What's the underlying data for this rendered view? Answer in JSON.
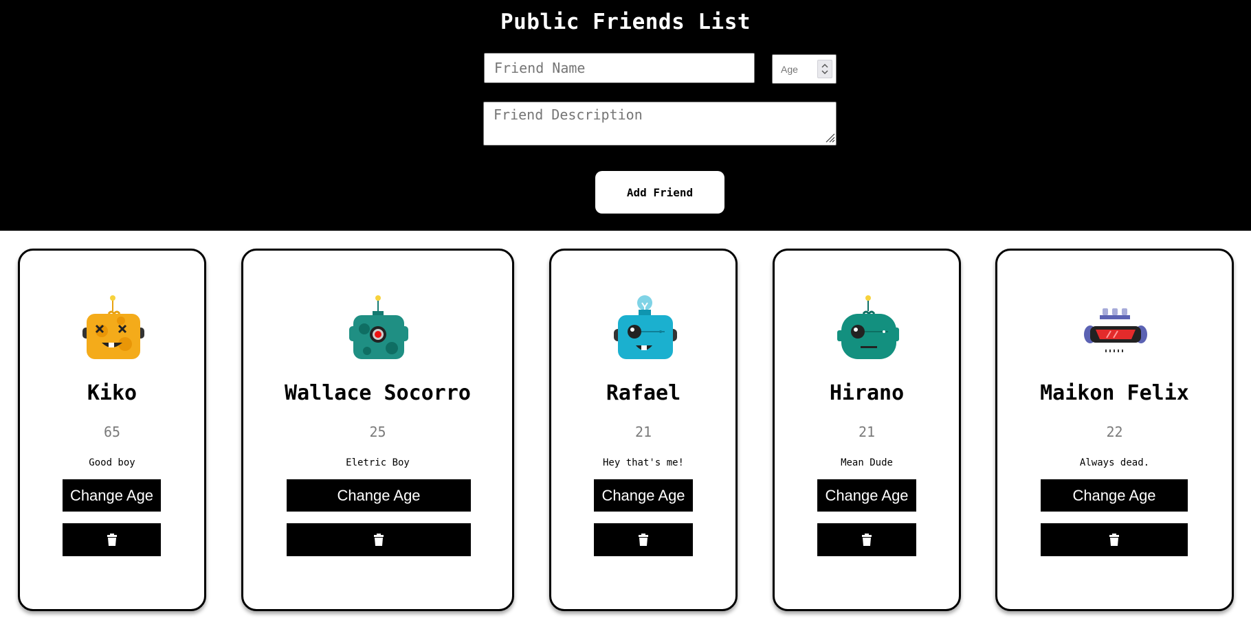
{
  "page_title": "Public Friends List",
  "form": {
    "name_placeholder": "Friend Name",
    "age_placeholder": "Age",
    "description_placeholder": "Friend Description",
    "add_button_label": "Add Friend"
  },
  "friends": [
    {
      "name": "Kiko",
      "age": "65",
      "description": "Good boy",
      "change_label": "Change Age",
      "avatar": "yellow-robot-dead-eyes",
      "color": "#f4ab1a"
    },
    {
      "name": "Wallace Socorro",
      "age": "25",
      "description": "Eletric Boy",
      "change_label": "Change Age",
      "avatar": "teal-robot-red-eye",
      "color": "#1f8f83"
    },
    {
      "name": "Rafael",
      "age": "21",
      "description": "Hey that's me!",
      "change_label": "Change Age",
      "avatar": "cyan-robot-bulb",
      "color": "#1bb0cf"
    },
    {
      "name": "Hirano",
      "age": "21",
      "description": "Mean Dude",
      "change_label": "Change Age",
      "avatar": "green-robot-monocle",
      "color": "#13907f"
    },
    {
      "name": "Maikon Felix",
      "age": "22",
      "description": "Always dead.",
      "change_label": "Change Age",
      "avatar": "visor-robot",
      "color": "#5b62b3"
    }
  ],
  "icons": {
    "delete": "trash-icon"
  }
}
